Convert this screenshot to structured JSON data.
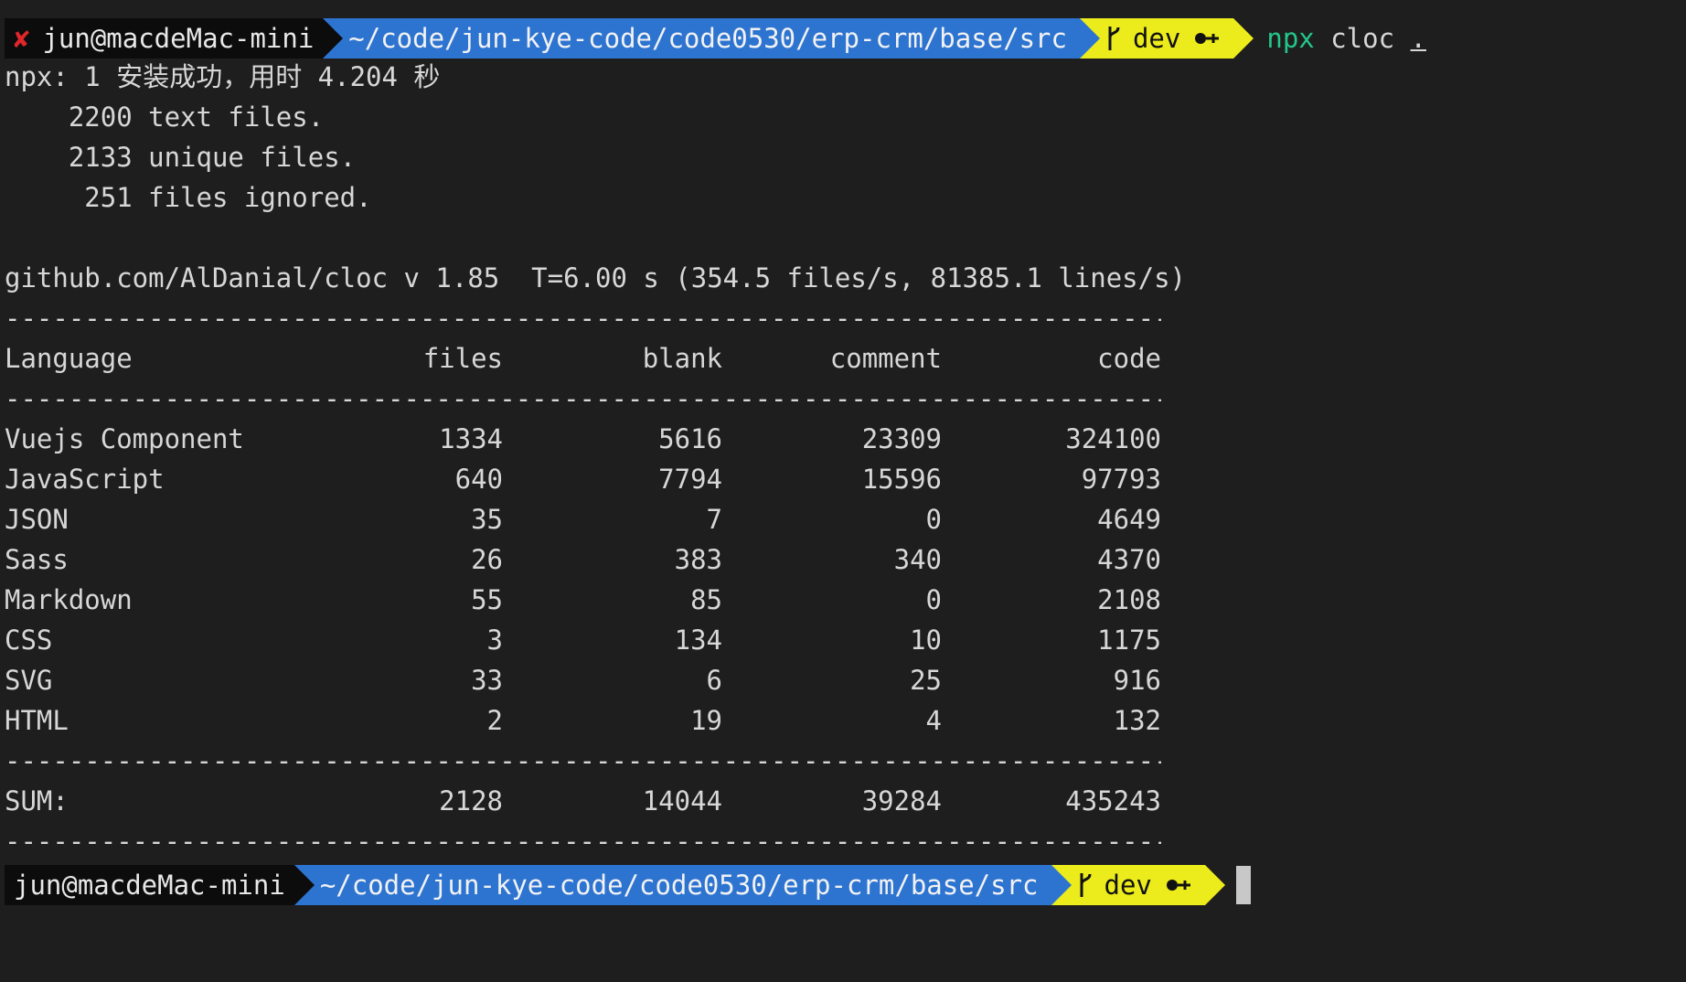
{
  "prompt1": {
    "status_mark": "✘",
    "user_host": "jun@macdeMac-mini",
    "path": "~/code/jun-kye-code/code0530/erp-crm/base/src",
    "branch": "dev",
    "command_bin": "npx",
    "command_arg": "cloc",
    "command_dot": "."
  },
  "output": {
    "npx_line": "npx: 1 安装成功，用时 4.204 秒",
    "text_files": "    2200 text files.",
    "unique_files": "    2133 unique files.",
    "ignored_files": "     251 files ignored.",
    "version_line": "github.com/AlDanial/cloc v 1.85  T=6.00 s (354.5 files/s, 81385.1 lines/s)",
    "dashes": "-------------------------------------------------------------------------------"
  },
  "table": {
    "headers": {
      "language": "Language",
      "files": "files",
      "blank": "blank",
      "comment": "comment",
      "code": "code"
    },
    "rows": [
      {
        "language": "Vuejs Component",
        "files": "1334",
        "blank": "5616",
        "comment": "23309",
        "code": "324100"
      },
      {
        "language": "JavaScript",
        "files": "640",
        "blank": "7794",
        "comment": "15596",
        "code": "97793"
      },
      {
        "language": "JSON",
        "files": "35",
        "blank": "7",
        "comment": "0",
        "code": "4649"
      },
      {
        "language": "Sass",
        "files": "26",
        "blank": "383",
        "comment": "340",
        "code": "4370"
      },
      {
        "language": "Markdown",
        "files": "55",
        "blank": "85",
        "comment": "0",
        "code": "2108"
      },
      {
        "language": "CSS",
        "files": "3",
        "blank": "134",
        "comment": "10",
        "code": "1175"
      },
      {
        "language": "SVG",
        "files": "33",
        "blank": "6",
        "comment": "25",
        "code": "916"
      },
      {
        "language": "HTML",
        "files": "2",
        "blank": "19",
        "comment": "4",
        "code": "132"
      }
    ],
    "sum": {
      "language": "SUM:",
      "files": "2128",
      "blank": "14044",
      "comment": "39284",
      "code": "435243"
    }
  },
  "prompt2": {
    "user_host": "jun@macdeMac-mini",
    "path": "~/code/jun-kye-code/code0530/erp-crm/base/src",
    "branch": "dev"
  },
  "icons": {
    "branch": "git-branch-icon",
    "key": "key-icon",
    "error": "error-x-icon"
  },
  "colors": {
    "background": "#1e1e1e",
    "path_segment": "#2d74d1",
    "git_segment": "#ecec1c",
    "error_mark": "#e0262a",
    "command": "#23c68b"
  }
}
